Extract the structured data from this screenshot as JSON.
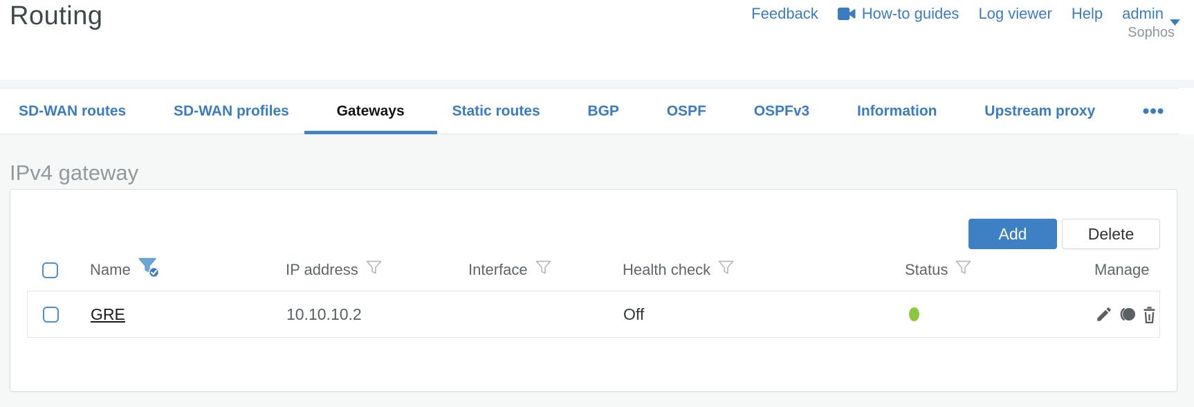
{
  "header": {
    "title": "Routing",
    "links": [
      "Feedback",
      "How-to guides",
      "Log viewer",
      "Help"
    ],
    "user": "admin",
    "brand": "Sophos"
  },
  "tab_bar": {
    "tabs": [
      {
        "label": "SD-WAN routes",
        "active": false
      },
      {
        "label": "SD-WAN profiles",
        "active": false
      },
      {
        "label": "Gateways",
        "active": true
      },
      {
        "label": "Static routes",
        "active": false
      },
      {
        "label": "BGP",
        "active": false
      },
      {
        "label": "OSPF",
        "active": false
      },
      {
        "label": "OSPFv3",
        "active": false
      },
      {
        "label": "Information",
        "active": false
      },
      {
        "label": "Upstream proxy",
        "active": false
      }
    ],
    "overflow_icon": "ellipsis-icon"
  },
  "section": {
    "title": "IPv4 gateway"
  },
  "toolbar": {
    "add_label": "Add",
    "delete_label": "Delete"
  },
  "table": {
    "columns": [
      {
        "label": "Name",
        "filter": "active"
      },
      {
        "label": "IP address",
        "filter": "inactive"
      },
      {
        "label": "Interface",
        "filter": "inactive"
      },
      {
        "label": "Health check",
        "filter": "inactive"
      },
      {
        "label": "Status",
        "filter": "inactive"
      },
      {
        "label": "Manage",
        "filter": "none"
      }
    ],
    "rows": [
      {
        "name": "GRE",
        "ip_address": "10.10.10.2",
        "interface": "",
        "health_check": "Off",
        "status": "up"
      }
    ],
    "manage_icons": [
      "edit-icon",
      "deactivate-icon",
      "delete-icon"
    ]
  },
  "icons": {
    "howto": "video-camera-icon",
    "user_menu": "chevron-down-icon",
    "filter": "funnel-icon",
    "filter_active": "funnel-check-icon"
  },
  "colors": {
    "accent_blue": "#3a7cc2",
    "button_blue": "#3d80c4",
    "status_green": "#8dc63f",
    "active_tab_text": "#121416",
    "checkbox_blue": "#4a90c8"
  }
}
